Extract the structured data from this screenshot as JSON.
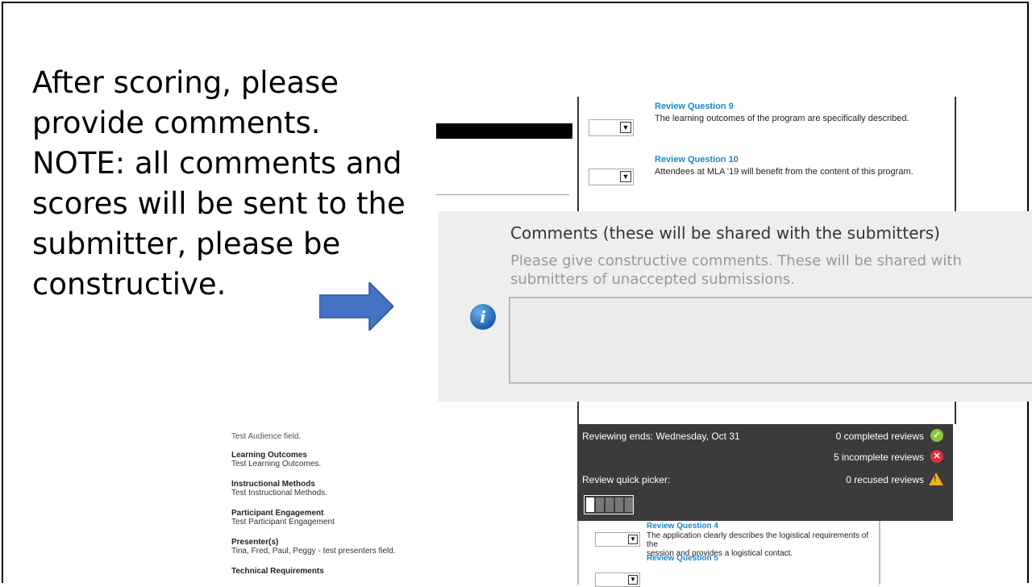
{
  "slide": {
    "lines": [
      "After scoring, please",
      "provide comments.",
      "NOTE: all comments and",
      "scores will be sent to the",
      "submitter, please be",
      "constructive."
    ]
  },
  "top_questions": [
    {
      "title": "Review Question 9",
      "text": "The learning outcomes of the program are specifically described."
    },
    {
      "title": "Review Question 10",
      "text": "Attendees at MLA '19 will benefit from the content of this program."
    }
  ],
  "comments": {
    "title": "Comments (these will be shared with the submitters)",
    "help_line1": "Please give constructive comments. These will be shared with",
    "help_line2": "submitters of unaccepted submissions.",
    "info_icon": "info-icon",
    "value": ""
  },
  "status": {
    "reviewing_ends": "Reviewing ends: Wednesday, Oct 31",
    "completed": "0 completed reviews",
    "incomplete": "5 incomplete reviews",
    "quick_picker_label": "Review quick picker:",
    "recused": "0 recused reviews",
    "colors": {
      "completed": "#8cc63f",
      "incomplete": "#e0303c",
      "recused": "#f2b01e",
      "panel": "#3b3b3b"
    }
  },
  "bottom_questions": [
    {
      "title": "Review Question 4",
      "line1": "The application clearly describes the logistical requirements of the",
      "line2": "session and provides a logistical contact."
    },
    {
      "title": "Review Question 5",
      "line1": "",
      "line2": ""
    }
  ],
  "left_fields": {
    "cut_text": "Test Audience field.",
    "items": [
      {
        "label": "Learning Outcomes",
        "value": "Test Learning Outcomes."
      },
      {
        "label": "Instructional Methods",
        "value": "Test Instructional Methods."
      },
      {
        "label": "Participant Engagement",
        "value": "Test Participant Engagement"
      },
      {
        "label": "Presenter(s)",
        "value": "Tina, Fred, Paul, Peggy - test presenters field."
      },
      {
        "label": "Technical Requirements",
        "value": ""
      }
    ]
  }
}
